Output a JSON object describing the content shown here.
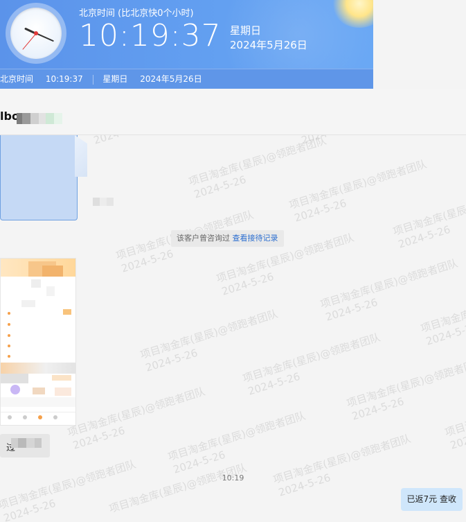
{
  "clock": {
    "caption": "北京时间 (比北京快0个小时)",
    "time": "10:19:37",
    "weekday": "星期日",
    "date": "2024年5月26日",
    "status_label": "北京时间",
    "status_time": "10:19:37",
    "status_weekday": "星期日",
    "status_date": "2024年5月26日",
    "accent_color": "#5b93ea"
  },
  "chat": {
    "contact_name_visible": "lbo",
    "system_notice": {
      "text": "该客户曾咨询过",
      "link": "查看接待记录"
    },
    "left_text_visible": "过",
    "time_divider": "10:19",
    "my_message": "已返7元 查收",
    "watermark": {
      "line1": "项目淘金库(星辰)@领跑者团队",
      "line2": "2024-5-26"
    }
  }
}
